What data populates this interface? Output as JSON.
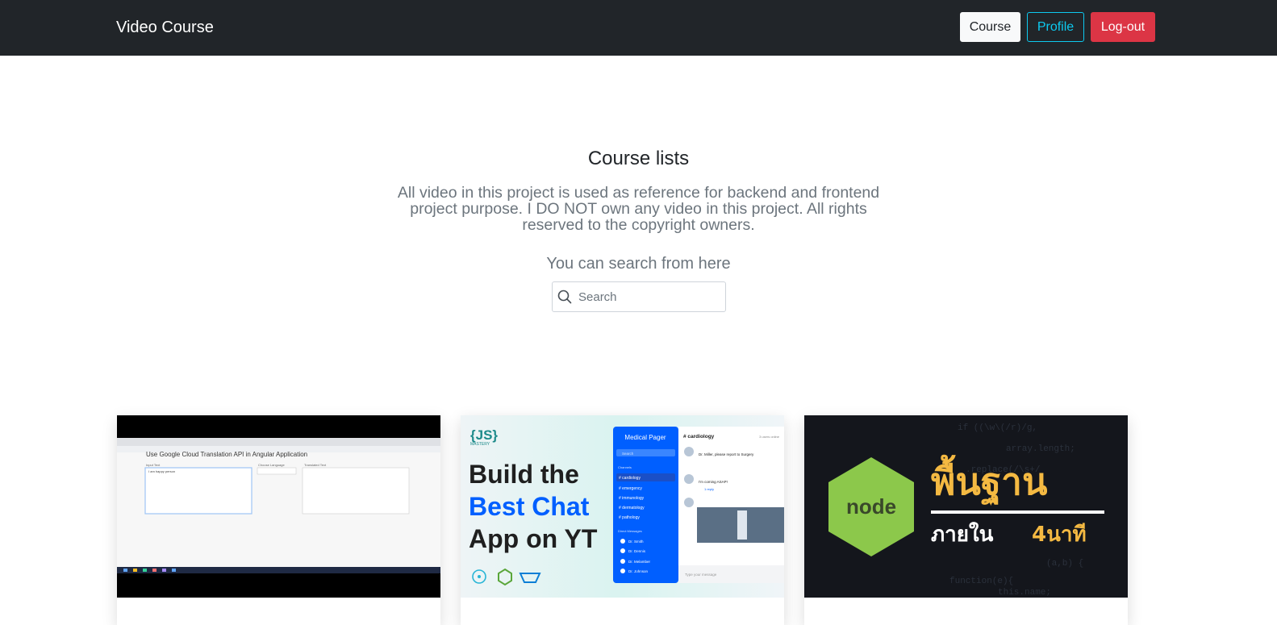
{
  "navbar": {
    "brand": "Video Course",
    "buttons": {
      "course": "Course",
      "profile": "Profile",
      "logout": "Log-out"
    }
  },
  "hero": {
    "title": "Course lists",
    "description": "All video in this project is used as reference for backend and frontend project purpose. I DO NOT own any video in this project. All rights reserved to the copyright owners.",
    "search_hint": "You can search from here",
    "search": {
      "placeholder": "Search",
      "icon": "search-icon"
    }
  },
  "courses": [
    {
      "thumbnail_text": "Use Google Cloud Translation API in Angular Application",
      "panel_labels": [
        "Input Text",
        "Choose Language",
        "Translated Text"
      ],
      "input_value": "I am happy person"
    },
    {
      "logo_top": "{JS}",
      "logo_bottom": "MASTERY",
      "headline_1": "Build the",
      "headline_2": "Best Chat",
      "headline_3": "App on YT",
      "app_title": "Medical Pager",
      "app_search": "Search",
      "app_channel_header": "Channels",
      "app_channels": [
        "# cardiology",
        "# emergency",
        "# immunology",
        "# dermatology",
        "# pathology"
      ],
      "app_dm_header": "Direct Messages",
      "app_dms": [
        "Dr. Smith",
        "Dr. Dennis",
        "Dr. Melamber",
        "Dr. Johnson"
      ],
      "chat_channel": "# cardiology",
      "chat_online": "3 users online",
      "chat_msg_1": "Dr. Miller, please report to Surgery",
      "chat_msg_2": "I'm coming ASAP!",
      "chat_reply": "1 reply",
      "chat_input": "Type your message"
    },
    {
      "logo_text": "node",
      "title_thai": "พื้นฐาน",
      "subtitle_thai": "ภายใน",
      "subtitle_accent": "4นาที"
    }
  ],
  "colors": {
    "navbar": "#212529",
    "profile": "#0dcaf0",
    "logout": "#dc3545",
    "node_green": "#8cc84b",
    "chat_blue": "#005fff",
    "thai_orange": "#f4b942"
  }
}
